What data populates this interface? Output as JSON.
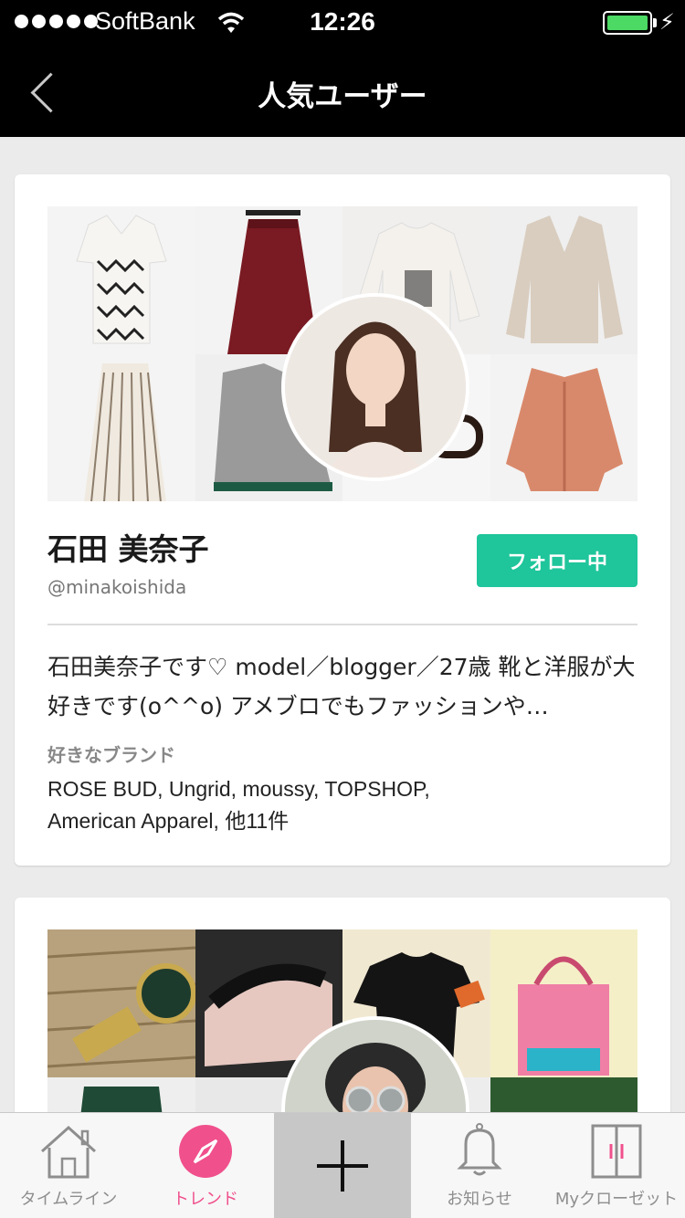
{
  "status_bar": {
    "carrier": "SoftBank",
    "time": "12:26",
    "battery_level": 1.0
  },
  "nav": {
    "title": "人気ユーザー",
    "back_icon": "chevron-left-icon"
  },
  "users": [
    {
      "name": "石田 美奈子",
      "handle": "@minakoishida",
      "follow_label": "フォロー中",
      "bio": "石田美奈子です♡ model／blogger／27歳 靴と洋服が大好きです(o^^o) アメブロでもファッションや…",
      "brands_label": "好きなブランド",
      "brands": "ROSE BUD, Ungrid, moussy, TOPSHOP, American Apparel, 他11件"
    },
    {
      "name": "",
      "handle": ""
    }
  ],
  "tabs": [
    {
      "label": "タイムライン",
      "icon": "home-icon"
    },
    {
      "label": "トレンド",
      "icon": "compass-icon",
      "active": true
    },
    {
      "label": "",
      "icon": "plus-icon"
    },
    {
      "label": "お知らせ",
      "icon": "bell-icon"
    },
    {
      "label": "Myクローゼット",
      "icon": "closet-icon"
    }
  ],
  "colors": {
    "accent_green": "#1fc59b",
    "accent_pink": "#f0508c",
    "header_bg": "#000000"
  }
}
